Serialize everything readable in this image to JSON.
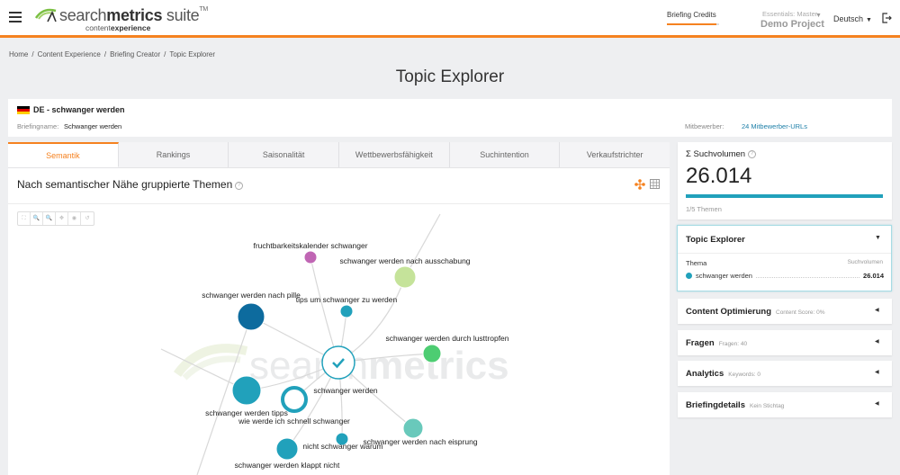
{
  "header": {
    "logo_main_light": "search",
    "logo_main_bold": "metrics",
    "logo_suffix": " suite",
    "logo_tm": "TM",
    "logo_sub_light": "content",
    "logo_sub_bold": "experience",
    "credits_label": "Briefing Credits",
    "credits_fraction": 0.95,
    "project_sub": "Essentials: Master",
    "project_name": "Demo Project",
    "language": "Deutsch",
    "accent_color": "#f58220"
  },
  "breadcrumb": [
    "Home",
    "Content Experience",
    "Briefing Creator",
    "Topic Explorer"
  ],
  "page_title": "Topic Explorer",
  "briefing": {
    "keyword": "DE - schwanger werden",
    "name_label": "Briefingname:",
    "name": "Schwanger werden",
    "competitors_label": "Mitbewerber:",
    "competitors_link": "24 Mitbewerber-URLs"
  },
  "tabs": [
    {
      "label": "Semantik",
      "active": true
    },
    {
      "label": "Rankings",
      "active": false
    },
    {
      "label": "Saisonalität",
      "active": false
    },
    {
      "label": "Wettbewerbsfähigkeit",
      "active": false
    },
    {
      "label": "Suchintention",
      "active": false
    },
    {
      "label": "Verkaufstrichter",
      "active": false
    }
  ],
  "section_title": "Nach semantischer Nähe gruppierte Themen",
  "help_glyph": "?",
  "zoom_toolbar": [
    {
      "name": "fit-icon",
      "glyph": "⛶"
    },
    {
      "name": "zoom-in-icon",
      "glyph": "🔍"
    },
    {
      "name": "zoom-out-icon",
      "glyph": "🔍"
    },
    {
      "name": "pan-icon",
      "glyph": "✥"
    },
    {
      "name": "center-icon",
      "glyph": "◉"
    },
    {
      "name": "reset-icon",
      "glyph": "↺"
    }
  ],
  "graph": {
    "watermark": "searchmetrics",
    "watermark_bold": "metrics",
    "center": {
      "label": "schwanger werden",
      "color": "#21a1bb",
      "selected": true
    },
    "nodes": [
      {
        "label": "fruchtbarkeitskalender schwanger",
        "color": "#c066b4",
        "size": "small"
      },
      {
        "label": "schwanger werden nach ausschabung",
        "color": "#c5e39a",
        "size": "medium"
      },
      {
        "label": "schwanger werden nach pille",
        "color": "#0d6b9e",
        "size": "large"
      },
      {
        "label": "tips um schwanger zu werden",
        "color": "#21a1bb",
        "size": "small"
      },
      {
        "label": "schwanger werden durch lusttropfen",
        "color": "#4dcd72",
        "size": "medium"
      },
      {
        "label": "schwanger werden tipps",
        "color": "#21a1bb",
        "size": "large"
      },
      {
        "label": "wie werde ich schnell schwanger",
        "color": "#21a1bb",
        "size": "medium",
        "ring": true
      },
      {
        "label": "schwanger werden nach eisprung",
        "color": "#69c9bb",
        "size": "medium"
      },
      {
        "label": "nicht schwanger warum",
        "color": "#21a1bb",
        "size": "small"
      },
      {
        "label": "schwanger werden klappt nicht",
        "color": "#21a1bb",
        "size": "medium"
      }
    ]
  },
  "volume": {
    "label": "Σ Suchvolumen",
    "value": "26.014",
    "fraction": 1.0,
    "sub": "1/5 Themen"
  },
  "topic_explorer": {
    "title": "Topic Explorer",
    "col_topic": "Thema",
    "col_volume": "Suchvolumen",
    "rows": [
      {
        "topic": "schwanger werden",
        "volume": "26.014",
        "color": "#21a1bb"
      }
    ]
  },
  "accordions": [
    {
      "title": "Content Optimierung",
      "sub": "Content Score: 0%"
    },
    {
      "title": "Fragen",
      "sub": "Fragen: 40"
    },
    {
      "title": "Analytics",
      "sub": "Keywords: 0"
    },
    {
      "title": "Briefingdetails",
      "sub": "Kein Stichtag"
    }
  ]
}
